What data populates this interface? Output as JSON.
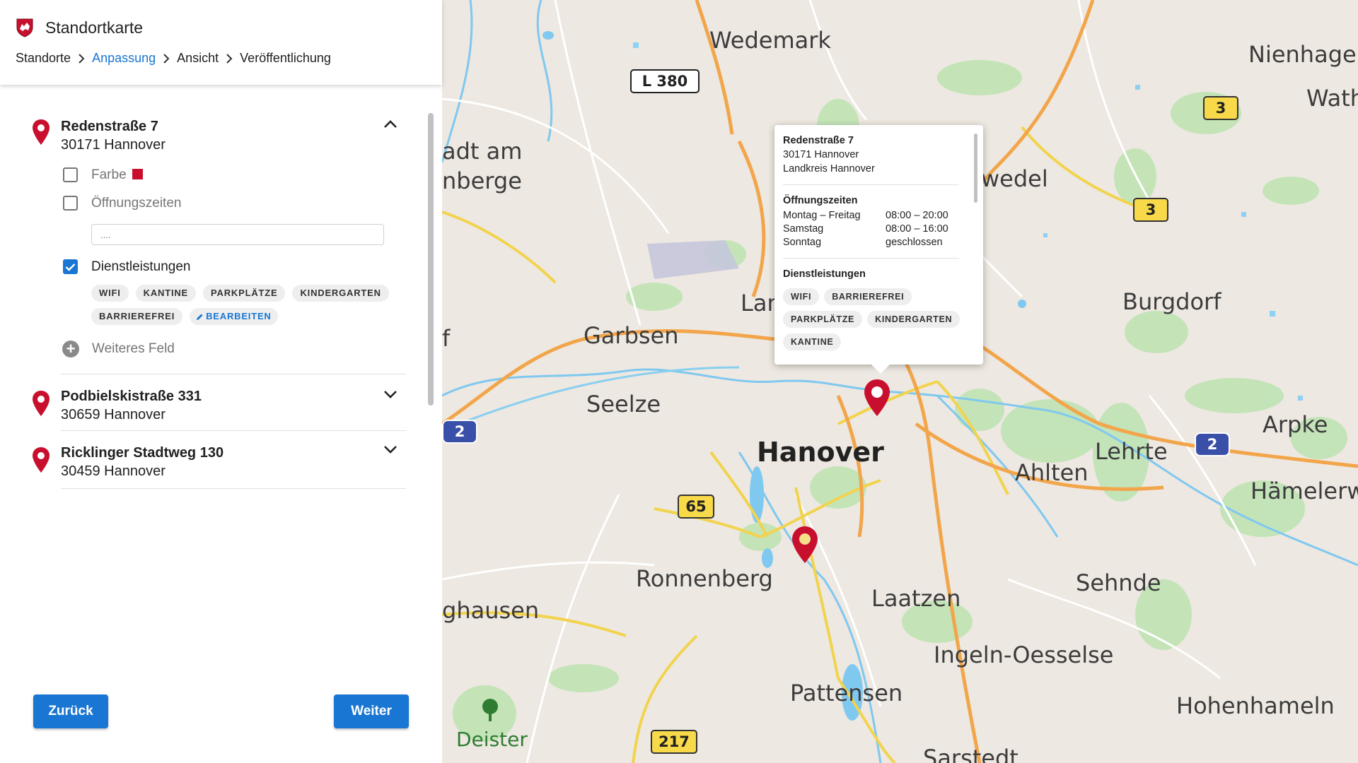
{
  "header": {
    "app_title": "Standortkarte",
    "breadcrumb": [
      "Standorte",
      "Anpassung",
      "Ansicht",
      "Veröffentlichung"
    ],
    "active_step": "Anpassung"
  },
  "colors": {
    "accent": "#1976d2",
    "marker": "#c8102e",
    "swatch": "#c8102e"
  },
  "locations": [
    {
      "street": "Redenstraße 7",
      "city": "30171 Hannover",
      "expanded": true,
      "fields": {
        "farbe_label": "Farbe",
        "farbe_checked": false,
        "oeffnungszeiten_label": "Öffnungszeiten",
        "oeffnungszeiten_checked": false,
        "oeffnungszeiten_placeholder": "....",
        "dienstleistungen_label": "Dienstleistungen",
        "dienstleistungen_checked": true,
        "services": [
          "WIFI",
          "KANTINE",
          "PARKPLÄTZE",
          "KINDERGARTEN",
          "BARRIEREFREI"
        ],
        "edit_label": "BEARBEITEN",
        "add_field_label": "Weiteres Feld"
      }
    },
    {
      "street": "Podbielskistraße 331",
      "city": "30659 Hannover",
      "expanded": false
    },
    {
      "street": "Ricklinger Stadtweg 130",
      "city": "30459 Hannover",
      "expanded": false
    }
  ],
  "buttons": {
    "back": "Zurück",
    "next": "Weiter"
  },
  "map": {
    "places": [
      "Wedemark",
      "Nienhagen",
      "Wath",
      "adt am",
      "nberge",
      "wedel",
      "Lan",
      "Burgdorf",
      "Garbsen",
      "f",
      "Seelze",
      "Arpke",
      "Hanover",
      "Lehrte",
      "Ahlten",
      "Hämelerw",
      "Ronnenberg",
      "Sehnde",
      "ghausen",
      "Laatzen",
      "Ingeln-Oesselse",
      "Pattensen",
      "Hohenhameln",
      "Deister",
      "Sarstedt"
    ],
    "road_shields": [
      "L 380",
      "3",
      "3",
      "2",
      "2",
      "65",
      "217"
    ],
    "popup": {
      "title": "Redenstraße 7",
      "city": "30171 Hannover",
      "district": "Landkreis Hannover",
      "hours_title": "Öffnungszeiten",
      "hours": [
        {
          "day": "Montag – Freitag",
          "time": "08:00 – 20:00"
        },
        {
          "day": "Samstag",
          "time": "08:00 – 16:00"
        },
        {
          "day": "Sonntag",
          "time": "geschlossen"
        }
      ],
      "services_title": "Dienstleistungen",
      "services": [
        "WIFI",
        "BARRIEREFREI",
        "PARKPLÄTZE",
        "KINDERGARTEN",
        "KANTINE"
      ]
    }
  }
}
